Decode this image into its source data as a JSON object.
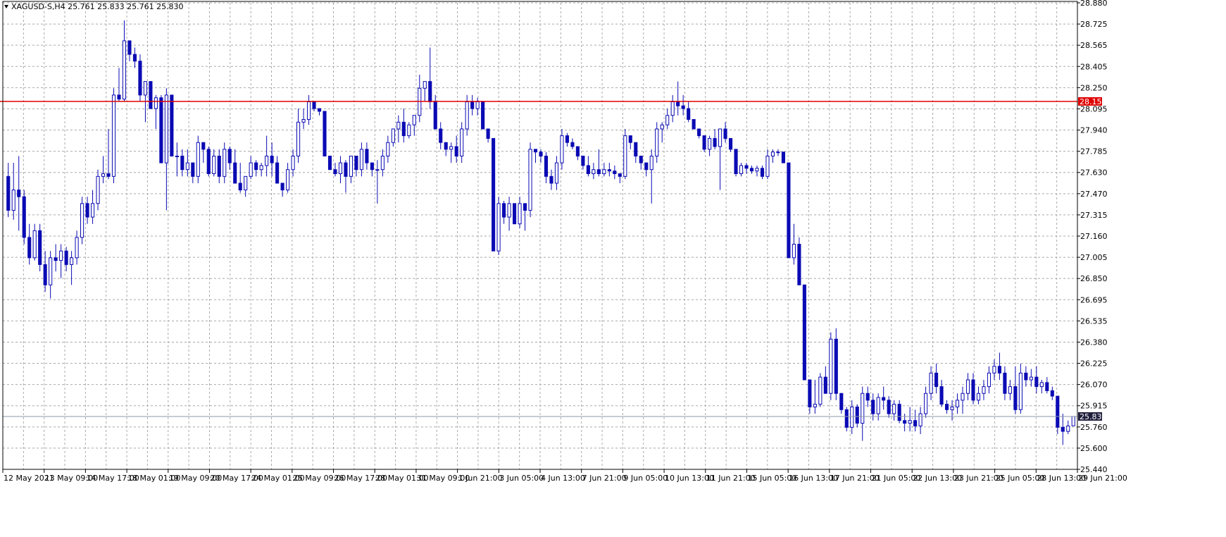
{
  "header": {
    "symbol_info": "XAGUSD-S,H4  25.761 25.833 25.761 25.830",
    "menu_icon": "triangle-down-icon"
  },
  "colors": {
    "background": "#ffffff",
    "grid": "#a9a9a9",
    "candle": "#0a0ab4",
    "resistance": "#e00000",
    "current_price_line": "#8a9aa8",
    "current_price_badge": "#1e1e3c"
  },
  "chart_data": {
    "type": "candlestick",
    "ylim": [
      25.44,
      28.88
    ],
    "y_ticks": [
      "28.880",
      "28.725",
      "28.565",
      "28.405",
      "28.250",
      "28.095",
      "27.940",
      "27.785",
      "27.630",
      "27.470",
      "27.315",
      "27.160",
      "27.005",
      "26.850",
      "26.695",
      "26.535",
      "26.380",
      "26.225",
      "26.070",
      "25.915",
      "25.760",
      "25.600",
      "25.440"
    ],
    "x_ticks": [
      "12 May 2021",
      "13 May 09:00",
      "14 May 17:00",
      "18 May 01:00",
      "19 May 09:00",
      "20 May 17:00",
      "24 May 01:00",
      "25 May 09:00",
      "26 May 17:00",
      "28 May 01:00",
      "31 May 09:00",
      "1 Jun 21:00",
      "3 Jun 05:00",
      "4 Jun 13:00",
      "7 Jun 21:00",
      "9 Jun 05:00",
      "10 Jun 13:00",
      "11 Jun 21:00",
      "15 Jun 05:00",
      "16 Jun 13:00",
      "17 Jun 21:00",
      "21 Jun 05:00",
      "22 Jun 13:00",
      "23 Jun 21:00",
      "25 Jun 05:00",
      "28 Jun 13:00",
      "29 Jun 21:00"
    ],
    "resistance_level": 28.153,
    "resistance_label": "28.153",
    "current_price": 25.83,
    "current_label": "25.830",
    "candles": [
      [
        27.6,
        27.7,
        27.3,
        27.35
      ],
      [
        27.35,
        27.7,
        27.28,
        27.5
      ],
      [
        27.5,
        27.75,
        27.2,
        27.45
      ],
      [
        27.45,
        27.5,
        27.1,
        27.15
      ],
      [
        27.15,
        27.25,
        26.95,
        27.0
      ],
      [
        27.0,
        27.25,
        26.98,
        27.2
      ],
      [
        27.2,
        27.25,
        26.9,
        26.95
      ],
      [
        26.95,
        27.05,
        26.75,
        26.8
      ],
      [
        26.8,
        27.05,
        26.7,
        27.0
      ],
      [
        27.0,
        27.1,
        26.9,
        26.98
      ],
      [
        26.98,
        27.1,
        26.85,
        27.05
      ],
      [
        27.05,
        27.08,
        26.9,
        26.95
      ],
      [
        26.95,
        27.05,
        26.8,
        27.0
      ],
      [
        27.0,
        27.2,
        26.95,
        27.15
      ],
      [
        27.15,
        27.45,
        27.1,
        27.4
      ],
      [
        27.4,
        27.45,
        27.25,
        27.3
      ],
      [
        27.3,
        27.5,
        27.25,
        27.4
      ],
      [
        27.4,
        27.65,
        27.35,
        27.6
      ],
      [
        27.6,
        27.75,
        27.55,
        27.62
      ],
      [
        27.62,
        27.95,
        27.58,
        27.6
      ],
      [
        27.6,
        28.25,
        27.55,
        28.2
      ],
      [
        28.2,
        28.4,
        28.15,
        28.17
      ],
      [
        28.17,
        28.75,
        28.15,
        28.6
      ],
      [
        28.6,
        28.6,
        28.45,
        28.5
      ],
      [
        28.5,
        28.55,
        28.4,
        28.45
      ],
      [
        28.45,
        28.5,
        28.15,
        28.2
      ],
      [
        28.2,
        28.3,
        28.0,
        28.3
      ],
      [
        28.3,
        28.3,
        28.1,
        28.1
      ],
      [
        28.1,
        28.2,
        27.95,
        28.18
      ],
      [
        28.18,
        28.2,
        27.7,
        27.7
      ],
      [
        27.7,
        28.25,
        27.35,
        28.2
      ],
      [
        28.2,
        28.2,
        27.75,
        27.75
      ],
      [
        27.75,
        27.85,
        27.6,
        27.75
      ],
      [
        27.75,
        27.8,
        27.6,
        27.65
      ],
      [
        27.65,
        27.8,
        27.6,
        27.7
      ],
      [
        27.7,
        27.7,
        27.55,
        27.6
      ],
      [
        27.6,
        27.9,
        27.55,
        27.85
      ],
      [
        27.85,
        27.85,
        27.7,
        27.8
      ],
      [
        27.8,
        27.82,
        27.6,
        27.62
      ],
      [
        27.62,
        27.8,
        27.6,
        27.75
      ],
      [
        27.75,
        27.8,
        27.55,
        27.6
      ],
      [
        27.6,
        27.85,
        27.55,
        27.8
      ],
      [
        27.8,
        27.82,
        27.65,
        27.7
      ],
      [
        27.7,
        27.8,
        27.55,
        27.55
      ],
      [
        27.55,
        27.7,
        27.48,
        27.5
      ],
      [
        27.5,
        27.6,
        27.45,
        27.6
      ],
      [
        27.6,
        27.75,
        27.58,
        27.7
      ],
      [
        27.7,
        27.72,
        27.6,
        27.65
      ],
      [
        27.65,
        27.7,
        27.6,
        27.68
      ],
      [
        27.68,
        27.9,
        27.6,
        27.75
      ],
      [
        27.75,
        27.85,
        27.6,
        27.7
      ],
      [
        27.7,
        27.75,
        27.55,
        27.55
      ],
      [
        27.55,
        27.55,
        27.45,
        27.5
      ],
      [
        27.5,
        27.7,
        27.48,
        27.65
      ],
      [
        27.65,
        27.8,
        27.6,
        27.75
      ],
      [
        27.75,
        28.1,
        27.7,
        28.0
      ],
      [
        28.0,
        28.1,
        27.95,
        28.02
      ],
      [
        28.02,
        28.2,
        27.98,
        28.15
      ],
      [
        28.15,
        28.15,
        28.08,
        28.1
      ],
      [
        28.1,
        28.1,
        28.05,
        28.08
      ],
      [
        28.08,
        28.08,
        27.75,
        27.75
      ],
      [
        27.75,
        27.75,
        27.65,
        27.65
      ],
      [
        27.65,
        27.7,
        27.6,
        27.62
      ],
      [
        27.62,
        27.75,
        27.55,
        27.7
      ],
      [
        27.7,
        27.72,
        27.48,
        27.6
      ],
      [
        27.6,
        27.75,
        27.55,
        27.75
      ],
      [
        27.75,
        27.75,
        27.6,
        27.65
      ],
      [
        27.65,
        27.85,
        27.6,
        27.8
      ],
      [
        27.8,
        27.85,
        27.65,
        27.7
      ],
      [
        27.7,
        27.7,
        27.6,
        27.65
      ],
      [
        27.65,
        27.72,
        27.4,
        27.65
      ],
      [
        27.65,
        27.8,
        27.6,
        27.75
      ],
      [
        27.75,
        27.9,
        27.7,
        27.85
      ],
      [
        27.85,
        27.95,
        27.82,
        27.95
      ],
      [
        27.95,
        28.05,
        27.85,
        28.0
      ],
      [
        28.0,
        28.1,
        27.85,
        27.9
      ],
      [
        27.9,
        28.0,
        27.88,
        27.98
      ],
      [
        27.98,
        28.05,
        27.9,
        28.05
      ],
      [
        28.05,
        28.35,
        28.0,
        28.25
      ],
      [
        28.25,
        28.3,
        28.15,
        28.3
      ],
      [
        28.3,
        28.55,
        28.1,
        28.15
      ],
      [
        28.15,
        28.2,
        27.95,
        27.95
      ],
      [
        27.95,
        28.0,
        27.8,
        27.85
      ],
      [
        27.85,
        27.85,
        27.75,
        27.8
      ],
      [
        27.8,
        27.85,
        27.7,
        27.82
      ],
      [
        27.82,
        27.9,
        27.7,
        27.75
      ],
      [
        27.75,
        28.0,
        27.7,
        27.95
      ],
      [
        27.95,
        28.2,
        27.9,
        28.15
      ],
      [
        28.15,
        28.2,
        28.05,
        28.1
      ],
      [
        28.1,
        28.18,
        28.05,
        28.15
      ],
      [
        28.15,
        28.15,
        27.95,
        27.95
      ],
      [
        27.95,
        27.95,
        27.85,
        27.88
      ],
      [
        27.88,
        27.88,
        27.05,
        27.05
      ],
      [
        27.05,
        27.45,
        27.02,
        27.4
      ],
      [
        27.4,
        27.42,
        27.25,
        27.3
      ],
      [
        27.3,
        27.45,
        27.2,
        27.4
      ],
      [
        27.4,
        27.4,
        27.25,
        27.25
      ],
      [
        27.25,
        27.45,
        27.22,
        27.4
      ],
      [
        27.4,
        27.38,
        27.2,
        27.35
      ],
      [
        27.35,
        27.85,
        27.3,
        27.8
      ],
      [
        27.8,
        27.8,
        27.7,
        27.78
      ],
      [
        27.78,
        27.8,
        27.7,
        27.75
      ],
      [
        27.75,
        27.78,
        27.55,
        27.6
      ],
      [
        27.6,
        27.65,
        27.5,
        27.55
      ],
      [
        27.55,
        27.75,
        27.5,
        27.7
      ],
      [
        27.7,
        27.95,
        27.65,
        27.9
      ],
      [
        27.9,
        27.92,
        27.82,
        27.85
      ],
      [
        27.85,
        27.88,
        27.8,
        27.82
      ],
      [
        27.82,
        27.82,
        27.72,
        27.75
      ],
      [
        27.75,
        27.75,
        27.65,
        27.68
      ],
      [
        27.68,
        27.75,
        27.6,
        27.62
      ],
      [
        27.62,
        27.7,
        27.58,
        27.65
      ],
      [
        27.65,
        27.8,
        27.6,
        27.62
      ],
      [
        27.62,
        27.7,
        27.6,
        27.65
      ],
      [
        27.65,
        27.7,
        27.6,
        27.64
      ],
      [
        27.64,
        27.68,
        27.58,
        27.62
      ],
      [
        27.62,
        27.6,
        27.55,
        27.6
      ],
      [
        27.6,
        27.95,
        27.58,
        27.9
      ],
      [
        27.9,
        27.9,
        27.8,
        27.85
      ],
      [
        27.85,
        27.85,
        27.7,
        27.75
      ],
      [
        27.75,
        27.75,
        27.65,
        27.7
      ],
      [
        27.7,
        27.7,
        27.6,
        27.65
      ],
      [
        27.65,
        27.8,
        27.4,
        27.75
      ],
      [
        27.75,
        28.0,
        27.7,
        27.95
      ],
      [
        27.95,
        28.0,
        27.85,
        27.98
      ],
      [
        27.98,
        28.1,
        27.95,
        28.05
      ],
      [
        28.05,
        28.2,
        28.0,
        28.15
      ],
      [
        28.15,
        28.3,
        28.05,
        28.12
      ],
      [
        28.12,
        28.2,
        28.05,
        28.1
      ],
      [
        28.1,
        28.15,
        28.0,
        28.02
      ],
      [
        28.02,
        28.02,
        27.95,
        27.95
      ],
      [
        27.95,
        27.95,
        27.88,
        27.9
      ],
      [
        27.9,
        27.9,
        27.78,
        27.8
      ],
      [
        27.8,
        27.9,
        27.75,
        27.88
      ],
      [
        27.88,
        27.95,
        27.8,
        27.82
      ],
      [
        27.82,
        27.95,
        27.5,
        27.95
      ],
      [
        27.95,
        28.0,
        27.85,
        27.88
      ],
      [
        27.88,
        27.88,
        27.78,
        27.8
      ],
      [
        27.8,
        27.8,
        27.6,
        27.62
      ],
      [
        27.62,
        27.7,
        27.6,
        27.68
      ],
      [
        27.68,
        27.7,
        27.62,
        27.66
      ],
      [
        27.66,
        27.68,
        27.62,
        27.64
      ],
      [
        27.64,
        27.68,
        27.6,
        27.66
      ],
      [
        27.66,
        27.68,
        27.58,
        27.6
      ],
      [
        27.6,
        27.8,
        27.58,
        27.75
      ],
      [
        27.75,
        27.8,
        27.7,
        27.78
      ],
      [
        27.78,
        27.8,
        27.75,
        27.78
      ],
      [
        27.78,
        27.78,
        27.7,
        27.7
      ],
      [
        27.7,
        27.7,
        27.0,
        27.0
      ],
      [
        27.0,
        27.25,
        26.95,
        27.1
      ],
      [
        27.1,
        27.15,
        26.8,
        26.8
      ],
      [
        26.8,
        26.8,
        26.1,
        26.1
      ],
      [
        26.1,
        26.1,
        25.85,
        25.9
      ],
      [
        25.9,
        26.1,
        25.85,
        25.92
      ],
      [
        25.92,
        26.15,
        25.9,
        26.12
      ],
      [
        26.12,
        26.2,
        26.0,
        26.0
      ],
      [
        26.0,
        26.45,
        25.95,
        26.4
      ],
      [
        26.4,
        26.48,
        25.95,
        26.0
      ],
      [
        26.0,
        26.0,
        25.85,
        25.88
      ],
      [
        25.88,
        25.9,
        25.72,
        25.75
      ],
      [
        25.75,
        25.95,
        25.7,
        25.9
      ],
      [
        25.9,
        25.92,
        25.75,
        25.78
      ],
      [
        25.78,
        26.05,
        25.65,
        26.0
      ],
      [
        26.0,
        26.05,
        25.9,
        25.95
      ],
      [
        25.95,
        26.0,
        25.8,
        25.85
      ],
      [
        25.85,
        26.0,
        25.8,
        25.97
      ],
      [
        25.97,
        26.05,
        25.88,
        25.95
      ],
      [
        25.95,
        25.98,
        25.82,
        25.85
      ],
      [
        25.85,
        25.95,
        25.8,
        25.92
      ],
      [
        25.92,
        25.95,
        25.78,
        25.8
      ],
      [
        25.8,
        25.85,
        25.72,
        25.78
      ],
      [
        25.78,
        25.9,
        25.72,
        25.8
      ],
      [
        25.8,
        25.88,
        25.72,
        25.76
      ],
      [
        25.76,
        25.9,
        25.7,
        25.85
      ],
      [
        25.85,
        26.05,
        25.82,
        26.0
      ],
      [
        26.0,
        26.2,
        25.95,
        26.15
      ],
      [
        26.15,
        26.22,
        26.0,
        26.05
      ],
      [
        26.05,
        26.1,
        25.9,
        25.92
      ],
      [
        25.92,
        25.95,
        25.85,
        25.88
      ],
      [
        25.88,
        25.95,
        25.8,
        25.9
      ],
      [
        25.9,
        26.0,
        25.85,
        25.95
      ],
      [
        25.95,
        26.05,
        25.85,
        26.0
      ],
      [
        26.0,
        26.15,
        25.95,
        26.1
      ],
      [
        26.1,
        26.15,
        25.92,
        25.95
      ],
      [
        25.95,
        26.05,
        25.92,
        26.0
      ],
      [
        26.0,
        26.1,
        25.95,
        26.05
      ],
      [
        26.05,
        26.2,
        26.0,
        26.15
      ],
      [
        26.15,
        26.25,
        26.1,
        26.2
      ],
      [
        26.2,
        26.3,
        26.1,
        26.15
      ],
      [
        26.15,
        26.2,
        25.95,
        26.0
      ],
      [
        26.0,
        26.1,
        25.95,
        26.05
      ],
      [
        26.05,
        26.2,
        25.85,
        25.88
      ],
      [
        25.88,
        26.22,
        25.85,
        26.15
      ],
      [
        26.15,
        26.2,
        26.05,
        26.1
      ],
      [
        26.1,
        26.18,
        26.05,
        26.12
      ],
      [
        26.12,
        26.2,
        26.0,
        26.05
      ],
      [
        26.05,
        26.1,
        26.0,
        26.08
      ],
      [
        26.08,
        26.12,
        26.0,
        26.02
      ],
      [
        26.02,
        26.05,
        25.95,
        25.98
      ],
      [
        25.98,
        25.98,
        25.7,
        25.75
      ],
      [
        25.75,
        25.85,
        25.62,
        25.72
      ],
      [
        25.72,
        25.8,
        25.7,
        25.76
      ],
      [
        25.761,
        25.833,
        25.761,
        25.83
      ]
    ]
  }
}
